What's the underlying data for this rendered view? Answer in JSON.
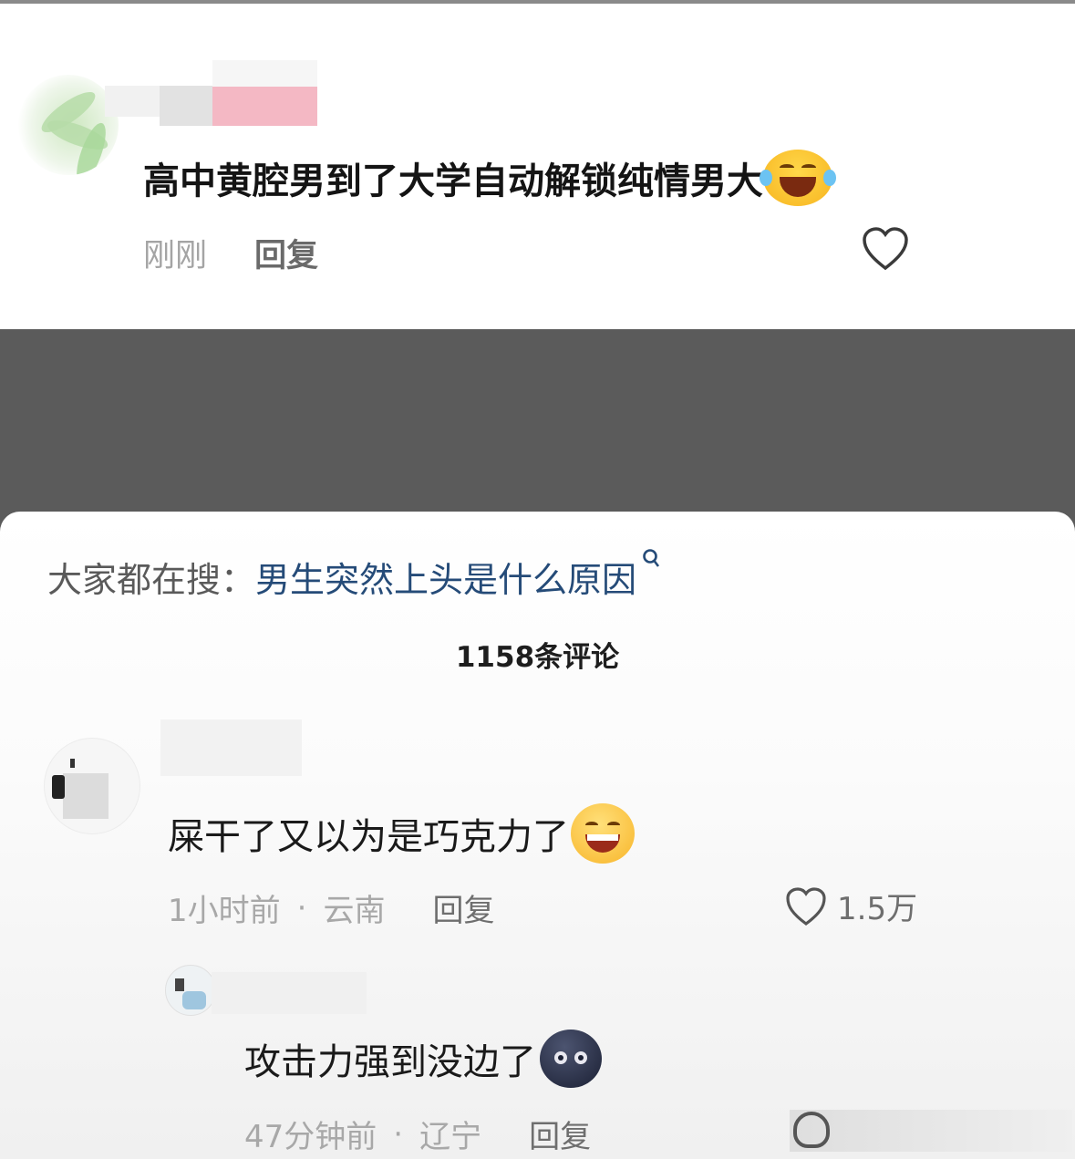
{
  "top_comment": {
    "text": "高中黄腔男到了大学自动解锁纯情男大",
    "time": "刚刚",
    "reply_label": "回复"
  },
  "search": {
    "prefix": "大家都在搜：",
    "term": "男生突然上头是什么原因"
  },
  "comments": {
    "count_label": "1158条评论",
    "items": [
      {
        "text": "屎干了又以为是巧克力了",
        "time": "1小时前",
        "separator": "·",
        "location": "云南",
        "reply_label": "回复",
        "likes": "1.5万"
      },
      {
        "text": "攻击力强到没边了",
        "time": "47分钟前",
        "separator": "·",
        "location": "辽宁",
        "reply_label": "回复"
      }
    ]
  },
  "colors": {
    "search_term": "#254b78",
    "muted": "#a8a8a8",
    "backdrop": "#5b5b5b"
  }
}
